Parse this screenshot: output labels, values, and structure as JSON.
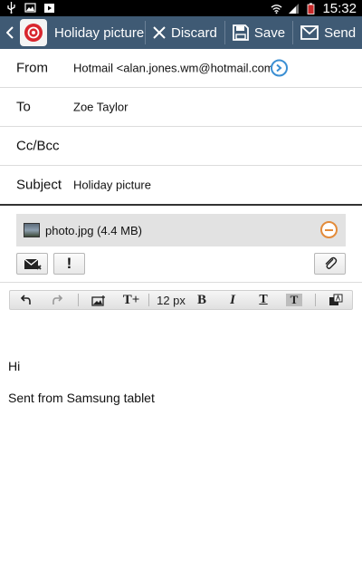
{
  "status_bar": {
    "time": "15:32",
    "battery_label": "",
    "icons": [
      "usb-icon",
      "image-icon",
      "play-store-icon",
      "wifi-icon",
      "signal-icon",
      "battery-icon"
    ]
  },
  "action_bar": {
    "app_icon": "email-app-icon",
    "title": "Holiday picture",
    "discard_label": "Discard",
    "save_label": "Save",
    "send_label": "Send",
    "background": "#3f5a74"
  },
  "compose": {
    "from": {
      "label": "From",
      "value": "Hotmail <alan.jones.wm@hotmail.com>"
    },
    "to": {
      "label": "To",
      "value": "Zoe Taylor"
    },
    "cc": {
      "label": "Cc/Bcc",
      "value": ""
    },
    "subject": {
      "label": "Subject",
      "value": "Holiday picture"
    }
  },
  "attachment": {
    "name": "photo.jpg (4.4 MB)"
  },
  "format_toolbar": {
    "undo": "undo-icon",
    "redo": "redo-icon",
    "insert_image": "insert-image-icon",
    "text_size_icon": "T+",
    "font_size": "12 px",
    "bold": "B",
    "italic": "I",
    "underline": "T",
    "highlight": "T"
  },
  "body": {
    "line1": "Hi",
    "line2": "Sent from Samsung tablet"
  },
  "colors": {
    "accent": "#3b8fd3",
    "remove": "#e38b3a"
  }
}
